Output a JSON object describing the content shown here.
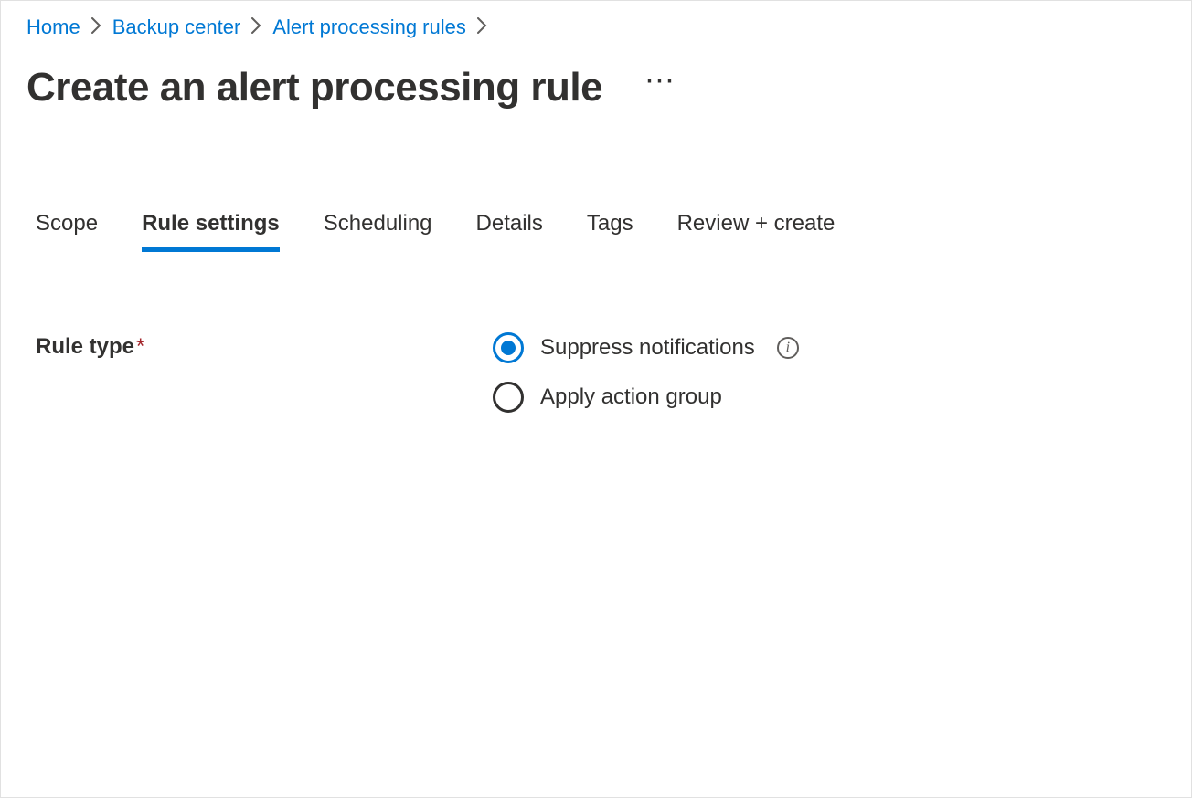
{
  "breadcrumb": {
    "items": [
      {
        "label": "Home"
      },
      {
        "label": "Backup center"
      },
      {
        "label": "Alert processing rules"
      }
    ]
  },
  "page": {
    "title": "Create an alert processing rule"
  },
  "tabs": [
    {
      "label": "Scope",
      "active": false
    },
    {
      "label": "Rule settings",
      "active": true
    },
    {
      "label": "Scheduling",
      "active": false
    },
    {
      "label": "Details",
      "active": false
    },
    {
      "label": "Tags",
      "active": false
    },
    {
      "label": "Review + create",
      "active": false
    }
  ],
  "form": {
    "rule_type": {
      "label": "Rule type",
      "required": true,
      "options": [
        {
          "label": "Suppress notifications",
          "selected": true,
          "has_info": true
        },
        {
          "label": "Apply action group",
          "selected": false,
          "has_info": false
        }
      ]
    }
  }
}
